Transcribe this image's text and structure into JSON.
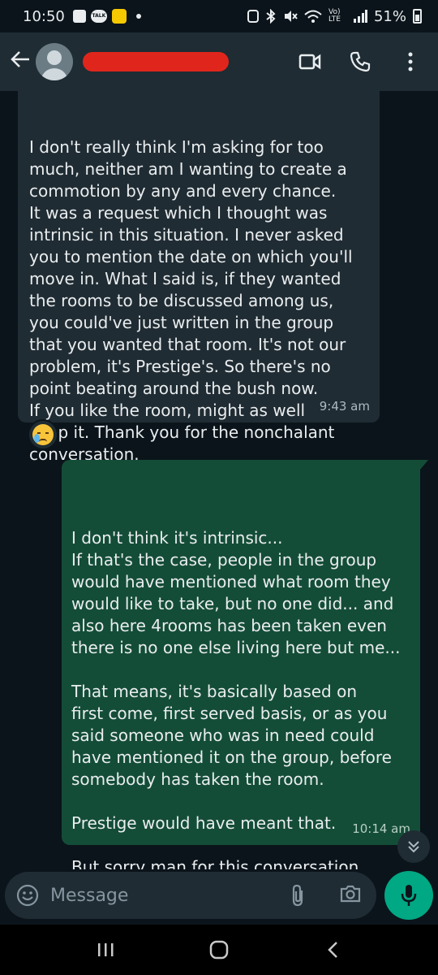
{
  "status_bar": {
    "time": "10:50",
    "talk_icon_text": "TALK",
    "network": "Vo) LTE",
    "battery": "51%"
  },
  "header": {
    "contact_name": "redacted",
    "icons": [
      "back-arrow-icon",
      "avatar",
      "video-call-icon",
      "voice-call-icon",
      "more-options-icon"
    ]
  },
  "messages": [
    {
      "direction": "incoming",
      "text": "I don't really think I'm asking for too\nmuch, neither am I wanting to create a\ncommotion by any and every chance.\nIt was a request which I thought was\nintrinsic in this situation. I never asked\nyou to mention the date on which you'll\nmove in. What I said is, if they wanted\nthe rooms to be discussed among us,\nyou could've just written in the group\nthat you wanted that room. It's not our\nproblem, it's Prestige's. So there's no\npoint beating around the bush now.\nIf you like the room, might as well\nkeep it. Thank you for the nonchalant\nconversation.",
      "time": "9:43 am",
      "reaction": "crying-face-emoji"
    },
    {
      "direction": "outgoing",
      "text": "I don't think it's intrinsic...\nIf that's the case, people in the group\nwould have mentioned what room they\nwould like to take, but no one did... and\nalso here 4rooms has been taken even\nthere is no one else living here but me...\n\nThat means, it's basically based on\nfirst come, first served basis, or as you\nsaid someone who was in need could\nhave mentioned it on the group, before\nsomebody has taken the room.\n\nPrestige would have meant that.\n\nBut sorry man for this conversation.\nI had no choice too",
      "time": "10:14 am"
    }
  ],
  "composer": {
    "placeholder": "Message"
  },
  "colors": {
    "incoming_bubble": "#202c33",
    "outgoing_bubble": "#144d37",
    "accent": "#00a884",
    "background": "#0b141a"
  }
}
